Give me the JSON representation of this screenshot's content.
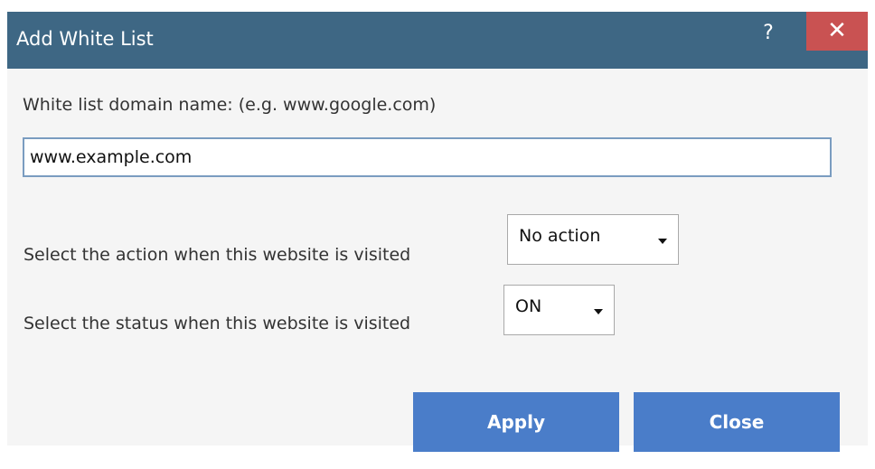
{
  "dialog": {
    "title": "Add White List",
    "help_label": "?",
    "close_icon_label": "✕"
  },
  "domain": {
    "label": "White list domain name: (e.g. www.google.com)",
    "value": "www.example.com"
  },
  "action": {
    "label": "Select the action when this website is visited",
    "selected": "No action"
  },
  "status": {
    "label": "Select the status when this website is visited",
    "selected": "ON"
  },
  "buttons": {
    "apply_label": "Apply",
    "close_label": "Close"
  },
  "colors": {
    "titlebar": "#3e6784",
    "close_button": "#c95252",
    "primary_button": "#4a7dc9",
    "input_border": "#7a9cc0"
  },
  "icons": {
    "help": "help-icon",
    "close": "close-icon",
    "dropdown": "chevron-down-icon"
  }
}
